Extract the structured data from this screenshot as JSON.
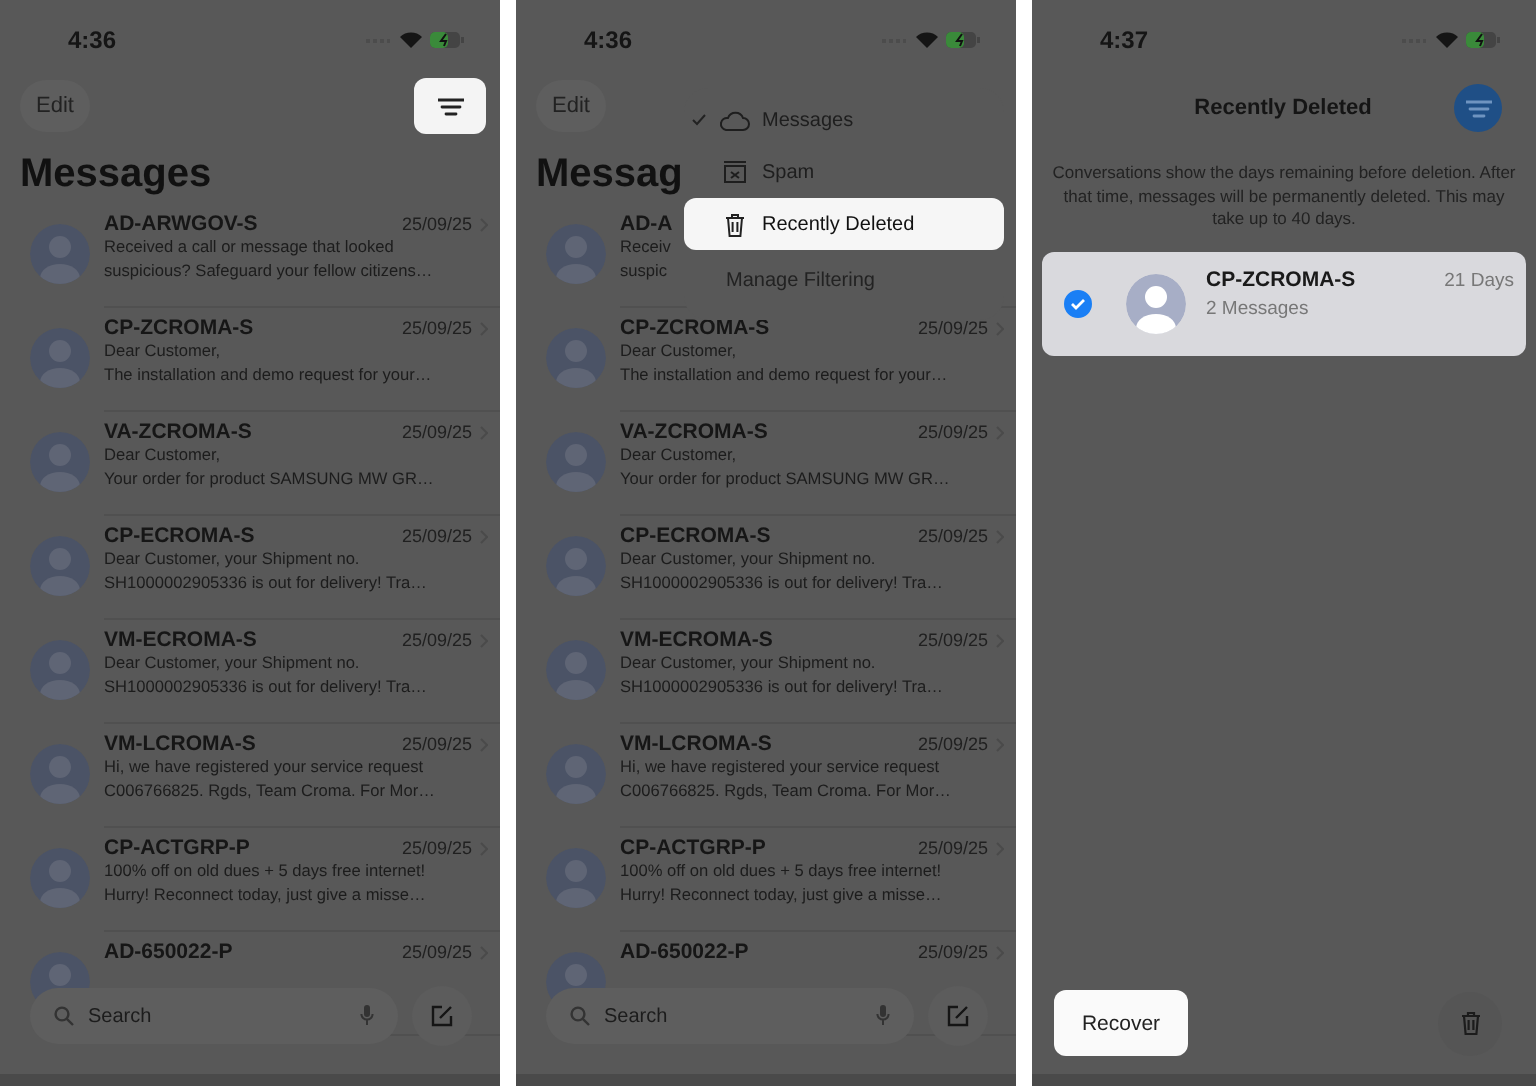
{
  "panels": [
    {
      "kind": "messages",
      "status": {
        "time": "4:36"
      },
      "edit_button": "Edit",
      "filter_button": {
        "highlighted": true
      },
      "title": "Messages",
      "conversations": [
        {
          "name": "AD-ARWGOV-S",
          "date": "25/09/25",
          "preview": [
            "Received a call or message that looked",
            "suspicious? Safeguard your fellow citizens…"
          ]
        },
        {
          "name": "CP-ZCROMA-S",
          "date": "25/09/25",
          "preview": [
            "Dear Customer,",
            "The installation and demo request for your…"
          ]
        },
        {
          "name": "VA-ZCROMA-S",
          "date": "25/09/25",
          "preview": [
            "Dear Customer,",
            "Your order for product SAMSUNG MW GR…"
          ]
        },
        {
          "name": "CP-ECROMA-S",
          "date": "25/09/25",
          "preview": [
            "Dear Customer, your Shipment no.",
            "SH1000002905336 is out for delivery! Tra…"
          ]
        },
        {
          "name": "VM-ECROMA-S",
          "date": "25/09/25",
          "preview": [
            "Dear Customer, your Shipment no.",
            "SH1000002905336 is out for delivery! Tra…"
          ]
        },
        {
          "name": "VM-LCROMA-S",
          "date": "25/09/25",
          "preview": [
            "Hi, we have registered your service request",
            "C006766825. Rgds, Team Croma. For Mor…"
          ]
        },
        {
          "name": "CP-ACTGRP-P",
          "date": "25/09/25",
          "preview": [
            "100% off on old dues + 5 days free internet!",
            "Hurry! Reconnect today, just give a misse…"
          ]
        },
        {
          "name": "AD-650022-P",
          "date": "25/09/25"
        }
      ],
      "search": {
        "placeholder": "Search"
      }
    },
    {
      "kind": "messages",
      "status": {
        "time": "4:36"
      },
      "edit_button": "Edit",
      "title": "Messag",
      "conversations": [
        {
          "name": "AD-A",
          "preview": [
            "Receiv",
            "suspic"
          ]
        },
        {
          "name": "CP-ZCROMA-S",
          "date": "25/09/25",
          "preview": [
            "Dear Customer,",
            "The installation and demo request for your…"
          ]
        },
        {
          "name": "VA-ZCROMA-S",
          "date": "25/09/25",
          "preview": [
            "Dear Customer,",
            "Your order for product SAMSUNG MW GR…"
          ]
        },
        {
          "name": "CP-ECROMA-S",
          "date": "25/09/25",
          "preview": [
            "Dear Customer, your Shipment no.",
            "SH1000002905336 is out for delivery! Tra…"
          ]
        },
        {
          "name": "VM-ECROMA-S",
          "date": "25/09/25",
          "preview": [
            "Dear Customer, your Shipment no.",
            "SH1000002905336 is out for delivery! Tra…"
          ]
        },
        {
          "name": "VM-LCROMA-S",
          "date": "25/09/25",
          "preview": [
            "Hi, we have registered your service request",
            "C006766825. Rgds, Team Croma. For Mor…"
          ]
        },
        {
          "name": "CP-ACTGRP-P",
          "date": "25/09/25",
          "preview": [
            "100% off on old dues + 5 days free internet!",
            "Hurry! Reconnect today, just give a misse…"
          ]
        },
        {
          "name": "AD-650022-P",
          "date": "25/09/25"
        }
      ],
      "menu": {
        "items": [
          {
            "label": "Messages",
            "checked": true,
            "selected": false
          },
          {
            "label": "Spam",
            "checked": false,
            "selected": false
          },
          {
            "label": "Recently Deleted",
            "checked": false,
            "selected": true
          }
        ],
        "footer": "Manage Filtering"
      },
      "search": {
        "placeholder": "Search"
      }
    },
    {
      "kind": "deleted",
      "status": {
        "time": "4:37"
      },
      "title": "Recently Deleted",
      "filter_button": {
        "active": true
      },
      "info": "Conversations show the days remaining before deletion. After that time, messages will be permanently deleted. This may take up to 40 days.",
      "conversations": [
        {
          "name": "CP-ZCROMA-S",
          "remaining": "21 Days",
          "count": "2 Messages",
          "selected": true
        }
      ],
      "recover_button": "Recover"
    }
  ]
}
